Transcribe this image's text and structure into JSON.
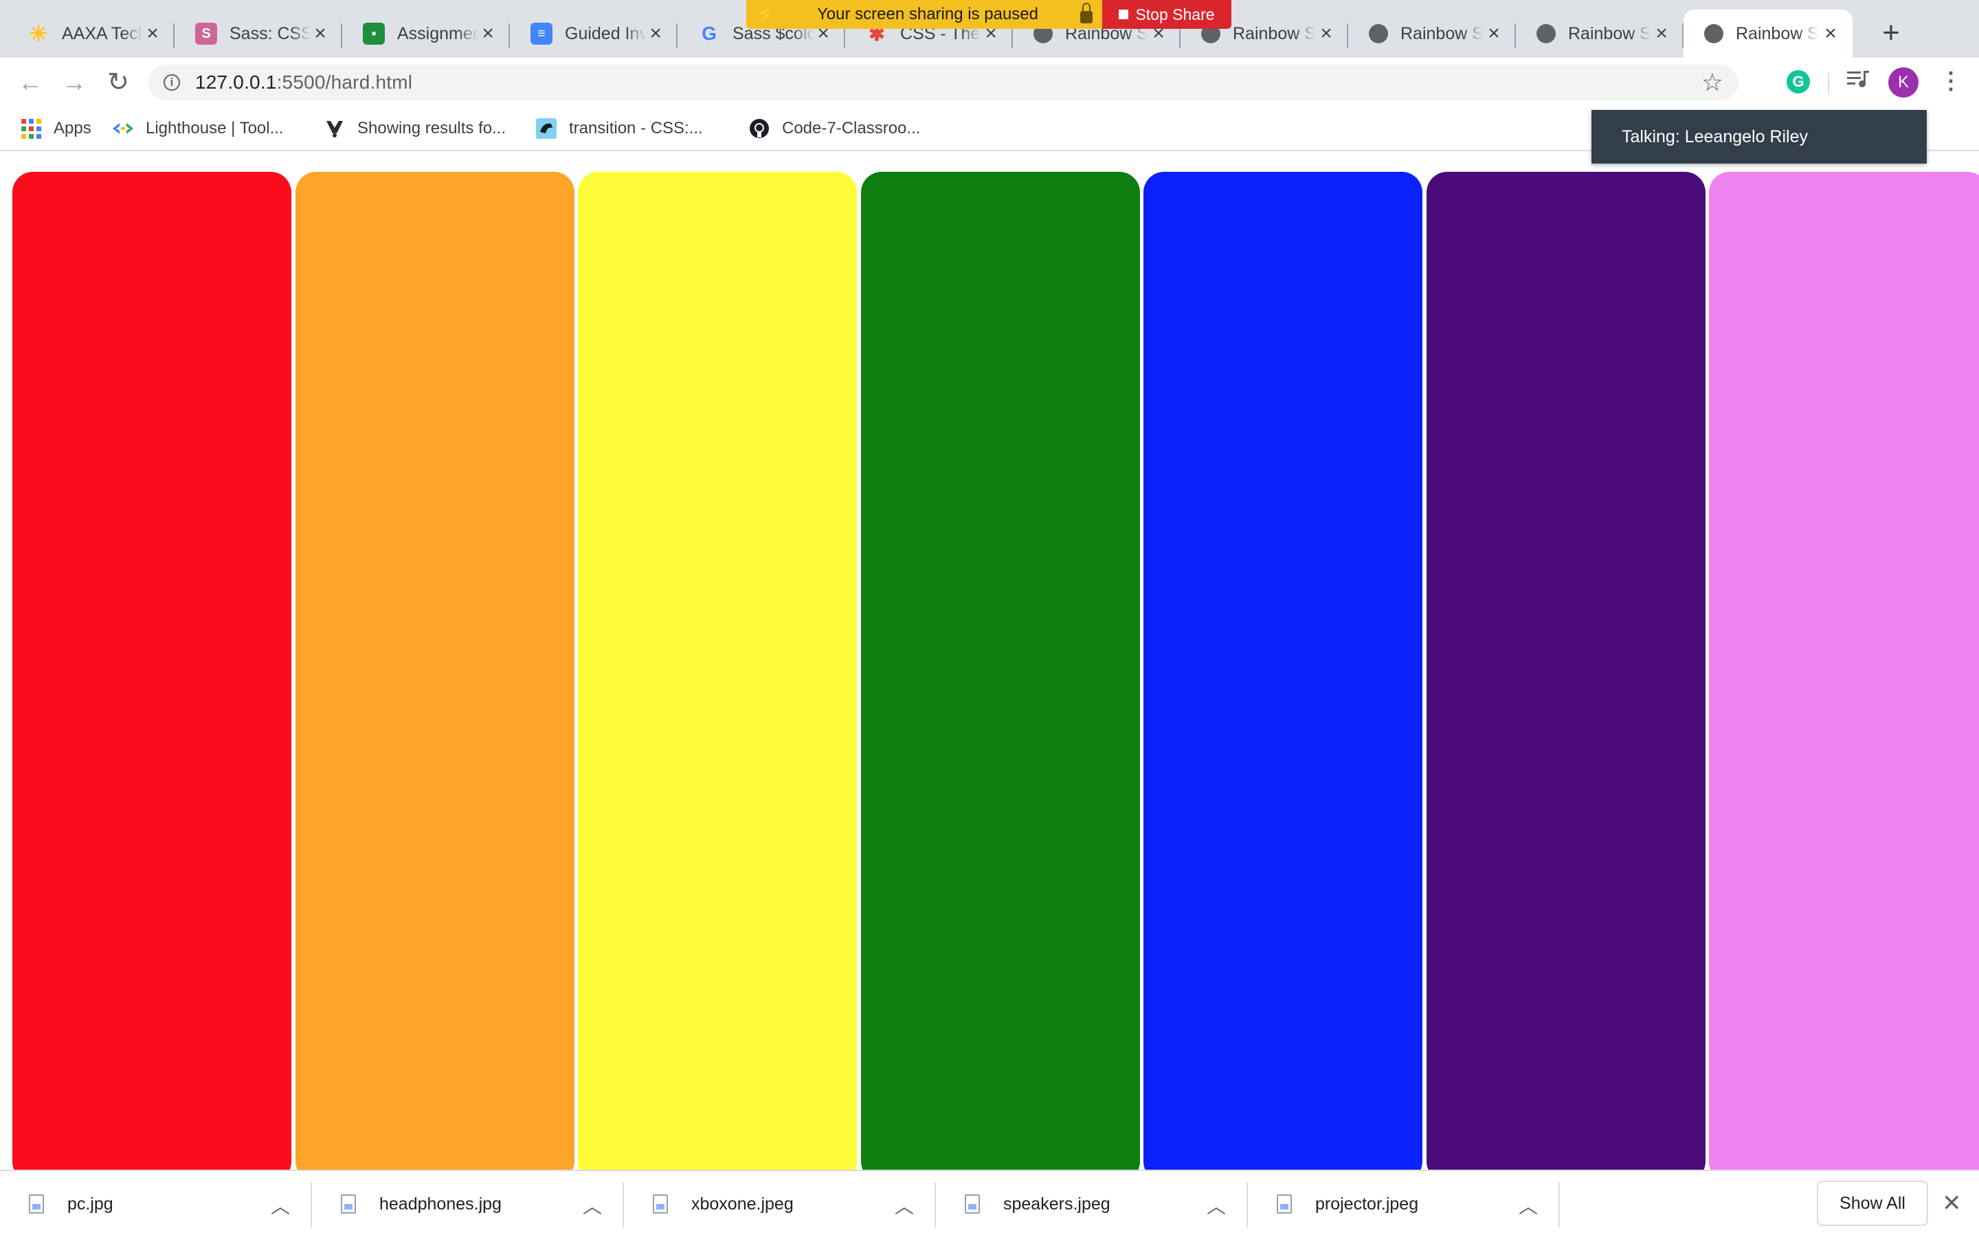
{
  "browser": {
    "tabs": [
      {
        "title": "AAXA Tech",
        "favicon": "walmart-spark-icon",
        "favicon_color": "#ffc220"
      },
      {
        "title": "Sass: CSS",
        "favicon": "sass-icon",
        "favicon_color": "#cd6799"
      },
      {
        "title": "Assignment",
        "favicon": "classroom-icon",
        "favicon_color": "#1e8e3e"
      },
      {
        "title": "Guided Inv",
        "favicon": "docs-icon",
        "favicon_color": "#4285f4"
      },
      {
        "title": "Sass $colo",
        "favicon": "google-icon",
        "favicon_color": "#4285f4"
      },
      {
        "title": "CSS - The",
        "favicon": "css-tricks-icon",
        "favicon_color": "#e8453c"
      },
      {
        "title": "Rainbow S",
        "favicon": "globe-icon",
        "favicon_color": "#5f6368"
      },
      {
        "title": "Rainbow S",
        "favicon": "globe-icon",
        "favicon_color": "#5f6368"
      },
      {
        "title": "Rainbow S",
        "favicon": "globe-icon",
        "favicon_color": "#5f6368"
      },
      {
        "title": "Rainbow S",
        "favicon": "globe-icon",
        "favicon_color": "#5f6368"
      },
      {
        "title": "Rainbow S",
        "favicon": "globe-icon",
        "favicon_color": "#5f6368",
        "active": true
      }
    ],
    "new_tab_symbol": "+",
    "screen_share": {
      "message": "Your screen sharing is paused",
      "stop_label": "Stop Share"
    },
    "url_host": "127.0.0.1",
    "url_path": ":5500/hard.html",
    "profile_initial": "K",
    "extension_initial": "G",
    "bookmarks": [
      {
        "label": "Apps",
        "icon": "apps-grid-icon"
      },
      {
        "label": "Lighthouse  |  Tool...",
        "icon": "lighthouse-icon"
      },
      {
        "label": "Showing results fo...",
        "icon": "stackoverflow-icon"
      },
      {
        "label": "transition - CSS:...",
        "icon": "mdn-icon"
      },
      {
        "label": "Code-7-Classroo...",
        "icon": "github-icon"
      }
    ],
    "tooltip": "Talking: Leeangelo Riley"
  },
  "page": {
    "stripes": [
      {
        "name": "red",
        "color": "#fc0d1b"
      },
      {
        "name": "orange",
        "color": "#fda429"
      },
      {
        "name": "yellow",
        "color": "#fefc38"
      },
      {
        "name": "green",
        "color": "#0f7f12"
      },
      {
        "name": "blue",
        "color": "#0c22fc"
      },
      {
        "name": "indigo",
        "color": "#4b0c7b"
      },
      {
        "name": "violet",
        "color": "#ee82ee"
      }
    ]
  },
  "downloads": {
    "items": [
      "pc.jpg",
      "headphones.jpg",
      "xboxone.jpeg",
      "speakers.jpeg",
      "projector.jpeg"
    ],
    "show_all": "Show All"
  }
}
